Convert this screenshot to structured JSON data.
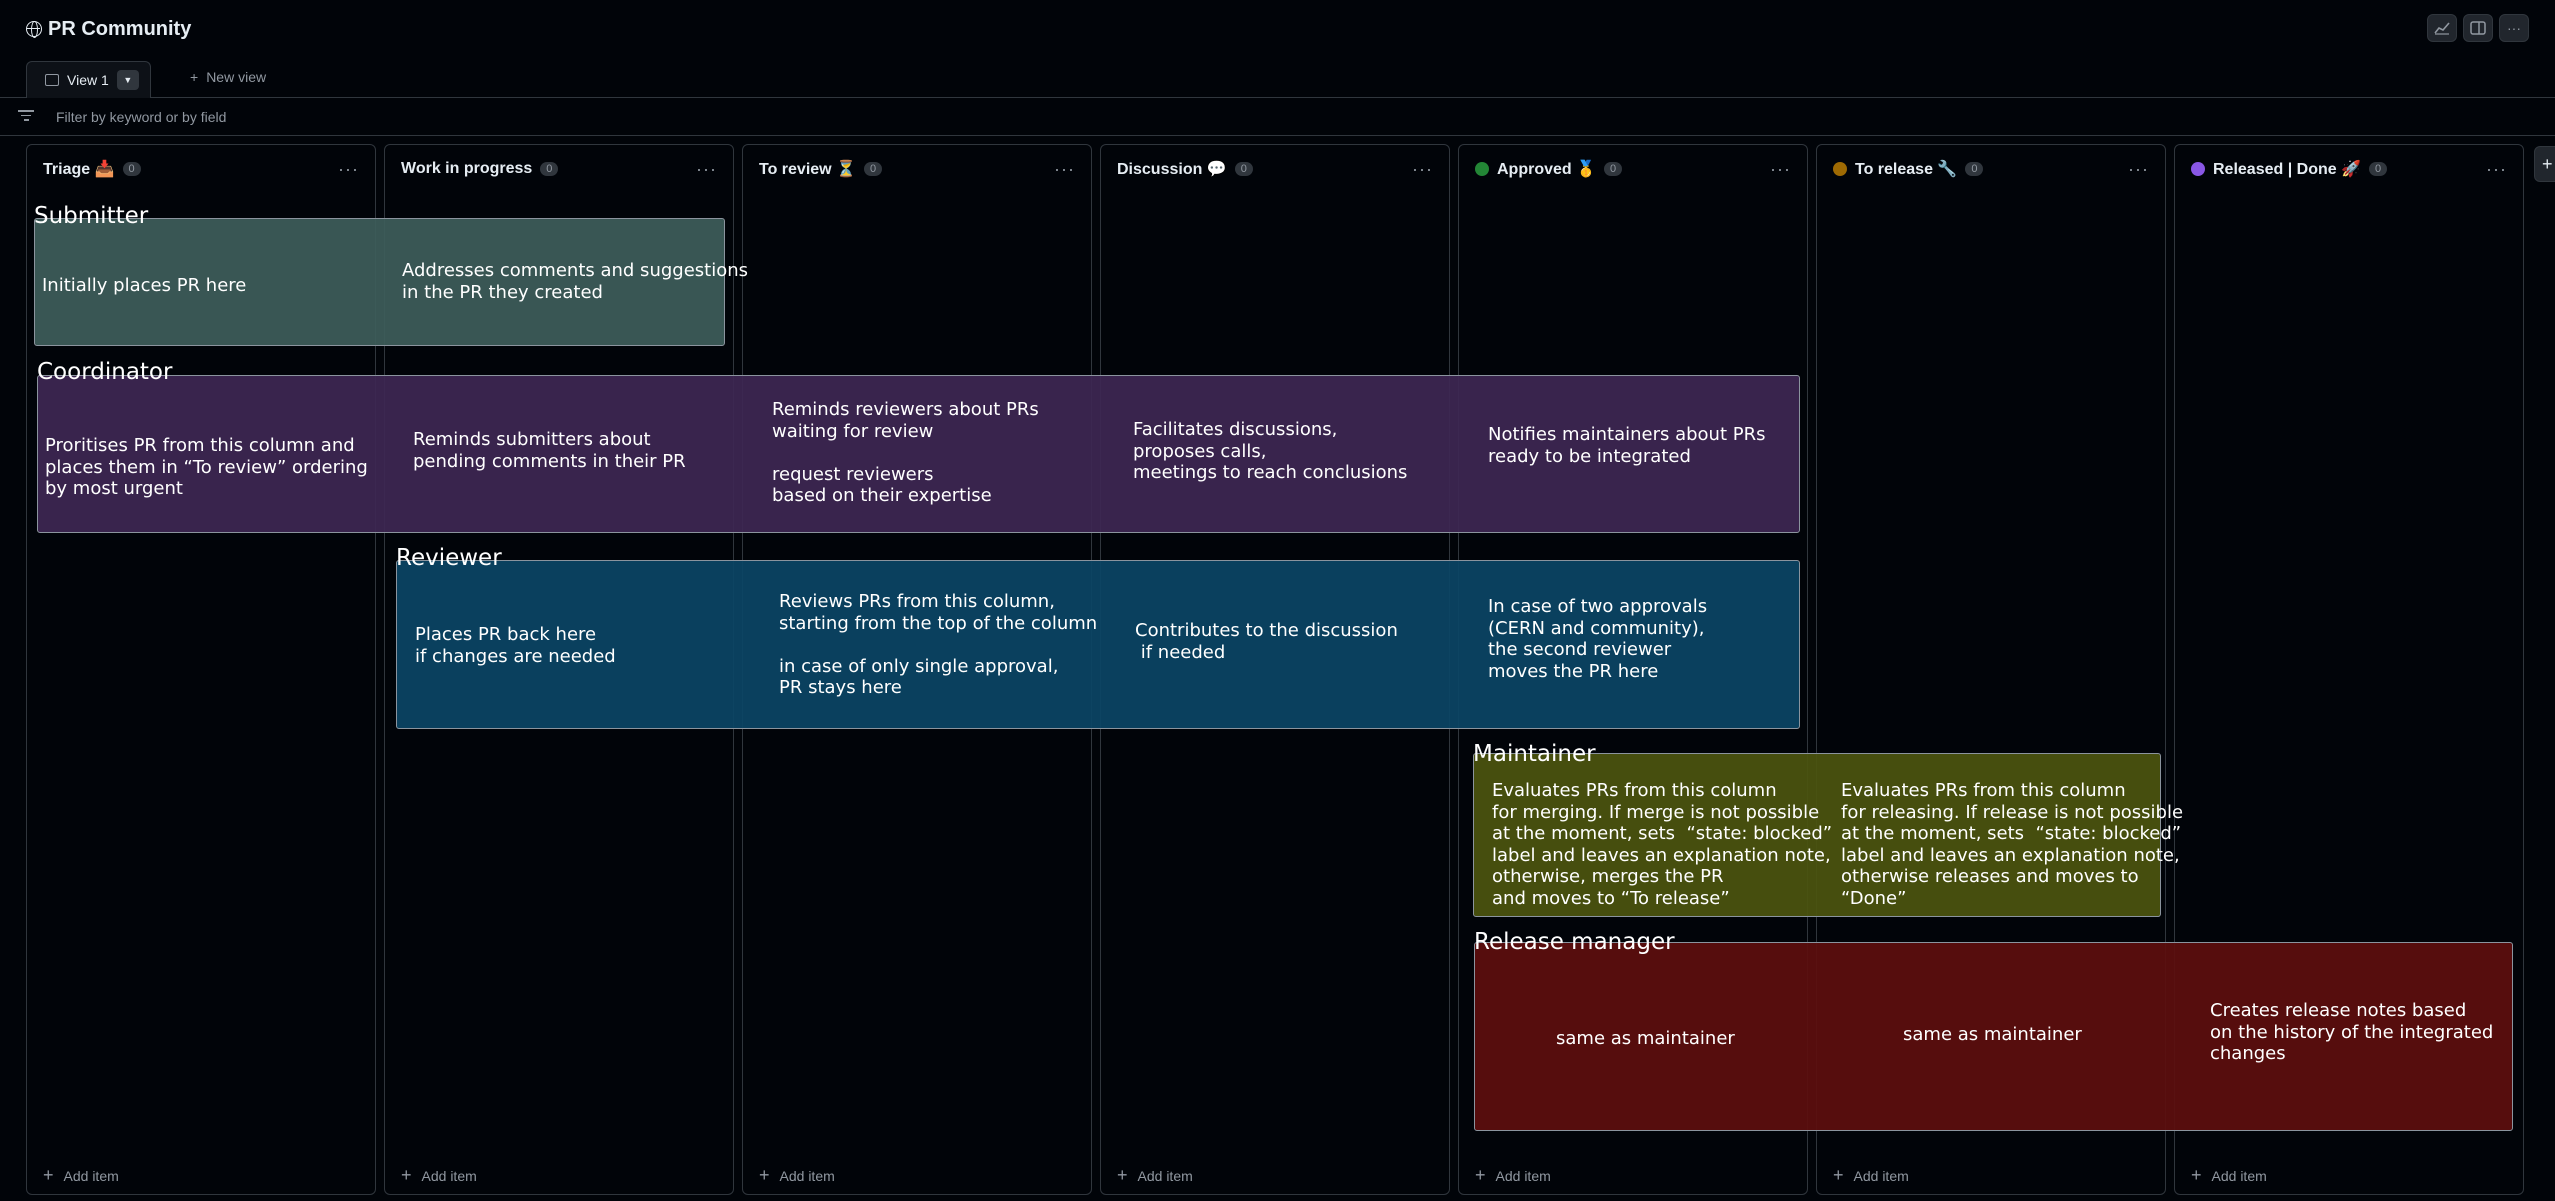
{
  "header": {
    "title": "PR Community",
    "actions": [
      "insights-icon",
      "layout-icon",
      "more-icon"
    ]
  },
  "views": {
    "active_tab": "View 1",
    "new_view_label": "New view"
  },
  "filter": {
    "placeholder": "Filter by keyword or by field"
  },
  "columns": [
    {
      "name": "Triage 📥",
      "count": "0",
      "add_label": "Add item"
    },
    {
      "name": "Work in progress",
      "count": "0",
      "add_label": "Add item"
    },
    {
      "name": "To review ⏳",
      "count": "0",
      "add_label": "Add item"
    },
    {
      "name": "Discussion 💬",
      "count": "0",
      "add_label": "Add item"
    },
    {
      "name": "Approved 🥇",
      "count": "0",
      "add_label": "Add item",
      "dot_color": "#238636"
    },
    {
      "name": "To release 🔧",
      "count": "0",
      "add_label": "Add item",
      "dot_color": "#9e6a03"
    },
    {
      "name": "Released | Done 🚀",
      "count": "0",
      "add_label": "Add item",
      "dot_color": "#8957e5"
    }
  ],
  "roles": {
    "submitter": {
      "label": "Submitter",
      "color": "#3d5c5a",
      "notes": [
        "Initially places PR here",
        "Addresses comments and suggestions\nin the PR they created"
      ]
    },
    "coordinator": {
      "label": "Coordinator",
      "color": "#3d2753",
      "notes": [
        "Proritises PR from this column and\nplaces them in “To review” ordering\nby most urgent",
        "Reminds submitters about\npending comments in their PR",
        "Reminds reviewers about PRs\nwaiting for review\n\nrequest reviewers\nbased on their expertise",
        "Facilitates discussions,\nproposes calls,\nmeetings to reach conclusions",
        "Notifies maintainers about PRs\nready to be integrated"
      ]
    },
    "reviewer": {
      "label": "Reviewer",
      "color": "#0b4565",
      "notes": [
        "Places PR back here\nif changes are needed",
        "Reviews PRs from this column,\nstarting from the top of the column\n\nin case of only single approval,\nPR stays here",
        "Contributes to the discussion\n if needed",
        "In case of two approvals\n(CERN and community),\nthe second reviewer\nmoves the PR here"
      ]
    },
    "maintainer": {
      "label": "Maintainer",
      "color": "#4b540f",
      "notes": [
        "Evaluates PRs from this column\nfor merging. If merge is not possible\nat the moment, sets  “state: blocked”\nlabel and leaves an explanation note,\notherwise, merges the PR\nand moves to “To release”",
        "Evaluates PRs from this column\nfor releasing. If release is not possible\nat the moment, sets  “state: blocked”\nlabel and leaves an explanation note,\notherwise releases and moves to\n“Done”"
      ]
    },
    "release_manager": {
      "label": "Release manager",
      "color": "#5c0e0e",
      "notes": [
        "same as maintainer",
        "same as maintainer",
        "Creates release notes based\non the history of the integrated\nchanges"
      ]
    }
  }
}
